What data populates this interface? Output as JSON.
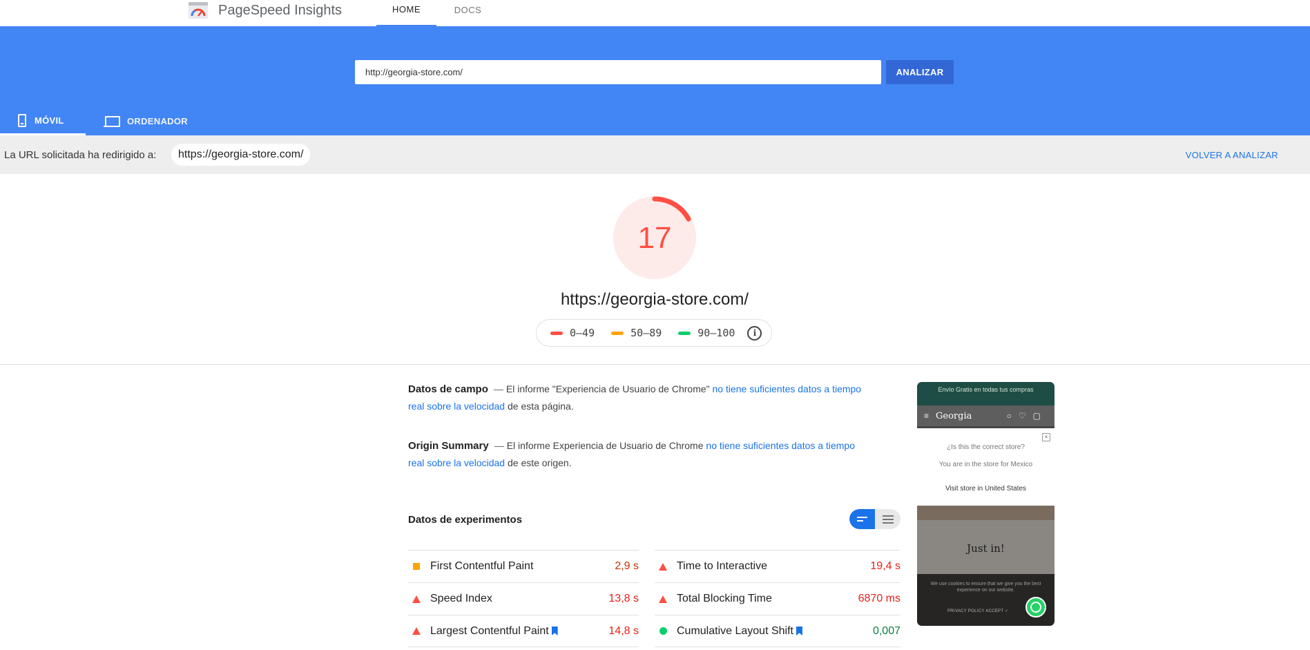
{
  "header": {
    "brand": "PageSpeed Insights",
    "tabs": [
      {
        "label": "HOME"
      },
      {
        "label": "DOCS"
      }
    ]
  },
  "search": {
    "value": "http://georgia-store.com/",
    "button": "ANALIZAR"
  },
  "device_tabs": [
    {
      "label": "MÓVIL"
    },
    {
      "label": "ORDENADOR"
    }
  ],
  "redirect": {
    "text": "La URL solicitada ha redirigido a:",
    "url": "https://georgia-store.com/",
    "reanalyze": "VOLVER A ANALIZAR"
  },
  "score": {
    "value": "17",
    "fraction": 0.17,
    "url": "https://georgia-store.com/",
    "color": "#ff4e42",
    "bg_color": "#fdebea"
  },
  "legend": [
    {
      "range": "0–49",
      "color": "#ff4e42"
    },
    {
      "range": "50–89",
      "color": "#ffa400"
    },
    {
      "range": "90–100",
      "color": "#0cce6b"
    }
  ],
  "field_data": {
    "heading": "Datos de campo",
    "prefix": "El informe \"Experiencia de Usuario de Chrome\"",
    "link": "no tiene suficientes datos a tiempo real sobre la velocidad",
    "suffix": "de esta página."
  },
  "origin_summary": {
    "heading": "Origin Summary",
    "prefix": "El informe Experiencia de Usuario de Chrome",
    "link": "no tiene suficientes datos a tiempo real sobre la velocidad",
    "suffix": "de este origen."
  },
  "lab": {
    "title": "Datos de experimentos",
    "left": [
      {
        "label": "First Contentful Paint",
        "value": "2,9 s",
        "status": "average",
        "bookmark": false
      },
      {
        "label": "Speed Index",
        "value": "13,8 s",
        "status": "fail",
        "bookmark": false
      },
      {
        "label": "Largest Contentful Paint",
        "value": "14,8 s",
        "status": "fail",
        "bookmark": true
      }
    ],
    "right": [
      {
        "label": "Time to Interactive",
        "value": "19,4 s",
        "status": "fail",
        "bookmark": false
      },
      {
        "label": "Total Blocking Time",
        "value": "6870 ms",
        "status": "fail",
        "bookmark": false
      },
      {
        "label": "Cumulative Layout Shift",
        "value": "0,007",
        "status": "pass",
        "bookmark": true
      }
    ]
  },
  "thumbnail": {
    "banner": "Envío Gratis en todas tus compras",
    "logo": "Georgia",
    "modal_question": "¿Is this the correct store?",
    "modal_sub": "You are in the store for Mexico",
    "modal_link": "Visit store in United States",
    "hero_title": "Just in!",
    "cookie_text": "We use cookies to ensure that we give you the best experience on our website.",
    "cookie_links": "PRIVACY POLICY     ACCEPT ✓"
  }
}
